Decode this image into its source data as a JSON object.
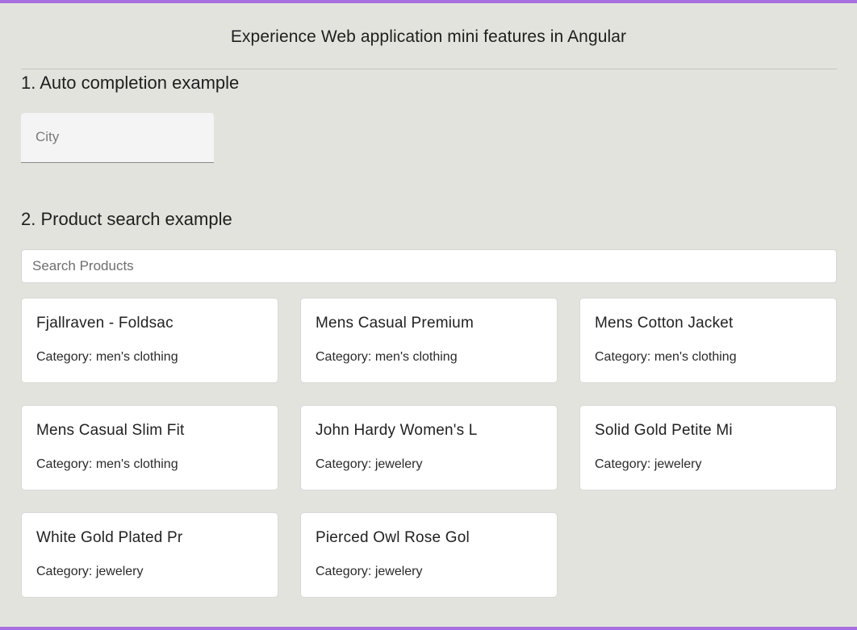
{
  "header": {
    "title": "Experience Web application mini features in Angular"
  },
  "autocomplete_section": {
    "heading": "1. Auto completion example",
    "city_input": {
      "placeholder": "City",
      "value": ""
    }
  },
  "product_section": {
    "heading": "2. Product search example",
    "search_input": {
      "placeholder": "Search Products",
      "value": ""
    },
    "products": [
      {
        "title": "Fjallraven - Foldsac",
        "category": "Category: men's clothing"
      },
      {
        "title": "Mens Casual Premium",
        "category": "Category: men's clothing"
      },
      {
        "title": "Mens Cotton Jacket",
        "category": "Category: men's clothing"
      },
      {
        "title": "Mens Casual Slim Fit",
        "category": "Category: men's clothing"
      },
      {
        "title": "John Hardy Women's L",
        "category": "Category: jewelery"
      },
      {
        "title": "Solid Gold Petite Mi",
        "category": "Category: jewelery"
      },
      {
        "title": "White Gold Plated Pr",
        "category": "Category: jewelery"
      },
      {
        "title": "Pierced Owl Rose Gol",
        "category": "Category: jewelery"
      }
    ]
  },
  "colors": {
    "accent_border": "#a86fe0",
    "background": "#e3e3de"
  }
}
